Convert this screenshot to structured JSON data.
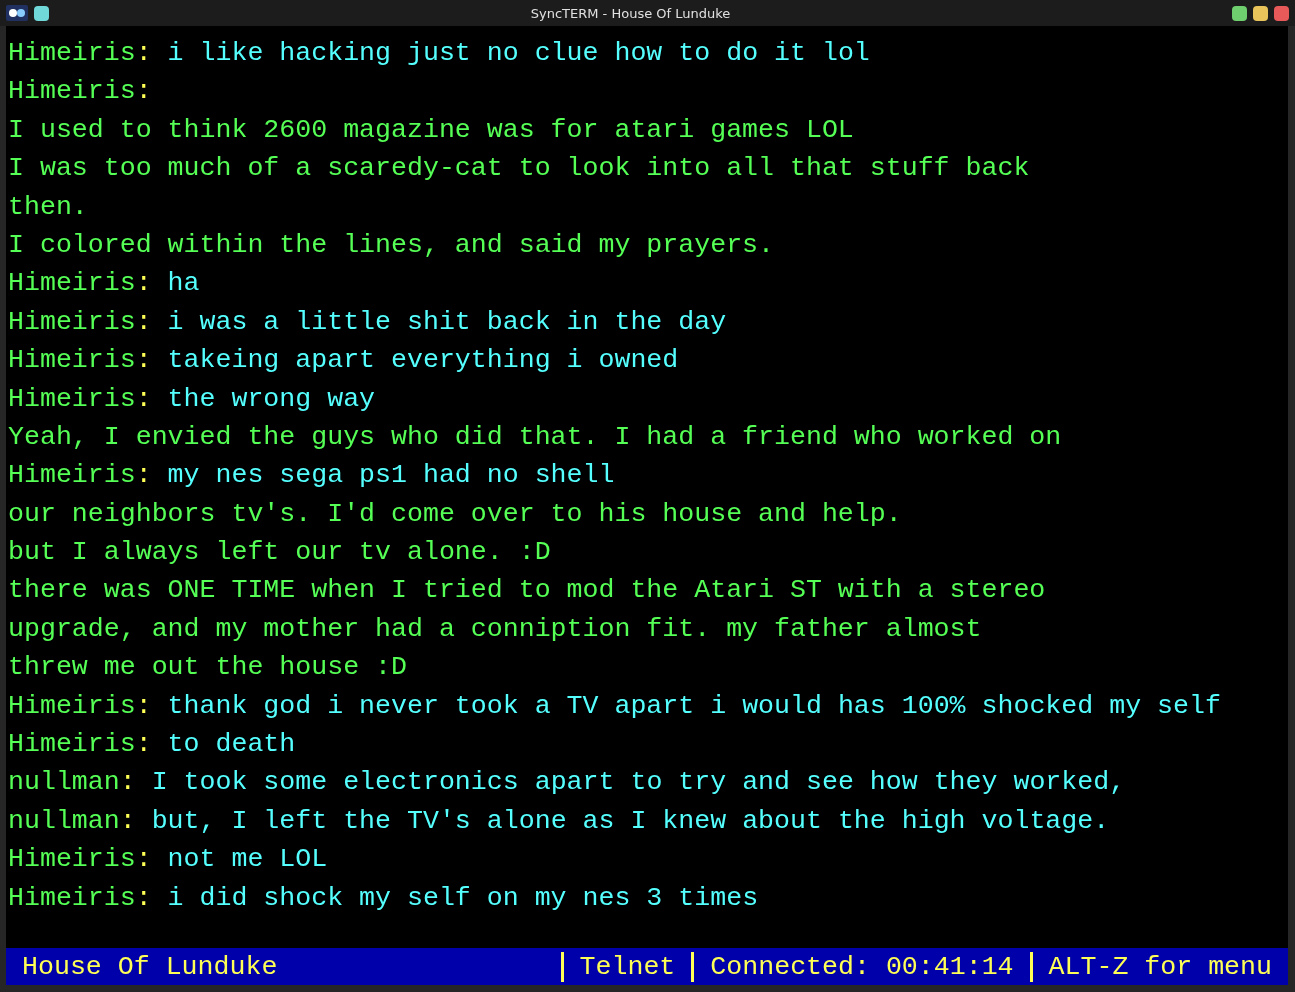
{
  "window": {
    "title": "SyncTERM - House Of Lunduke"
  },
  "terminal": {
    "lines": [
      {
        "kind": "message",
        "name": "Himeiris",
        "colon": ":",
        "text": "i like hacking just no clue how to do it lol"
      },
      {
        "kind": "message",
        "name": "Himeiris",
        "colon": ":"
      },
      {
        "kind": "plain",
        "text": "I used to think 2600 magazine was for atari games LOL"
      },
      {
        "kind": "plain",
        "text": "I was too much of a scaredy-cat to look into all that stuff back"
      },
      {
        "kind": "plain",
        "text": "then."
      },
      {
        "kind": "plain",
        "text": "I colored within the lines, and said my prayers."
      },
      {
        "kind": "message",
        "name": "Himeiris",
        "colon": ":",
        "text": "ha"
      },
      {
        "kind": "message",
        "name": "Himeiris",
        "colon": ":",
        "text": "i was a little shit back in the day"
      },
      {
        "kind": "message",
        "name": "Himeiris",
        "colon": ":",
        "text": "takeing apart everything i owned"
      },
      {
        "kind": "message",
        "name": "Himeiris",
        "colon": ":",
        "text": "the wrong way"
      },
      {
        "kind": "plain",
        "text": "Yeah, I envied the guys who did that. I had a friend who worked on"
      },
      {
        "kind": "message",
        "name": "Himeiris",
        "colon": ":",
        "text": "my nes sega ps1 had no shell"
      },
      {
        "kind": "plain",
        "text": "our neighbors tv's. I'd come over to his house and help."
      },
      {
        "kind": "plain",
        "text": "but I always left our tv alone. :D"
      },
      {
        "kind": "plain",
        "text": "there was ONE TIME when I tried to mod the Atari ST with a stereo"
      },
      {
        "kind": "plain",
        "text": "upgrade, and my mother had a conniption fit. my father almost"
      },
      {
        "kind": "plain",
        "text": "threw me out the house :D"
      },
      {
        "kind": "message",
        "name": "Himeiris",
        "colon": ":",
        "text": "thank god i never took a TV apart i would has 100% shocked my self"
      },
      {
        "kind": "message",
        "name": "Himeiris",
        "colon": ":",
        "text": "to death"
      },
      {
        "kind": "message",
        "name": "nullman",
        "colon": ":",
        "text": "I took some electronics apart to try and see how they worked,"
      },
      {
        "kind": "message",
        "name": "nullman",
        "colon": ":",
        "text": "but, I left the TV's alone as I knew about the high voltage."
      },
      {
        "kind": "message",
        "name": "Himeiris",
        "colon": ":",
        "text": "not me LOL"
      },
      {
        "kind": "message",
        "name": "Himeiris",
        "colon": ":",
        "text": "i did shock my self on my nes 3 times"
      }
    ]
  },
  "status_bar": {
    "segments": [
      "House Of Lunduke",
      "Telnet",
      "Connected: 00:41:14",
      "ALT-Z for menu"
    ]
  }
}
